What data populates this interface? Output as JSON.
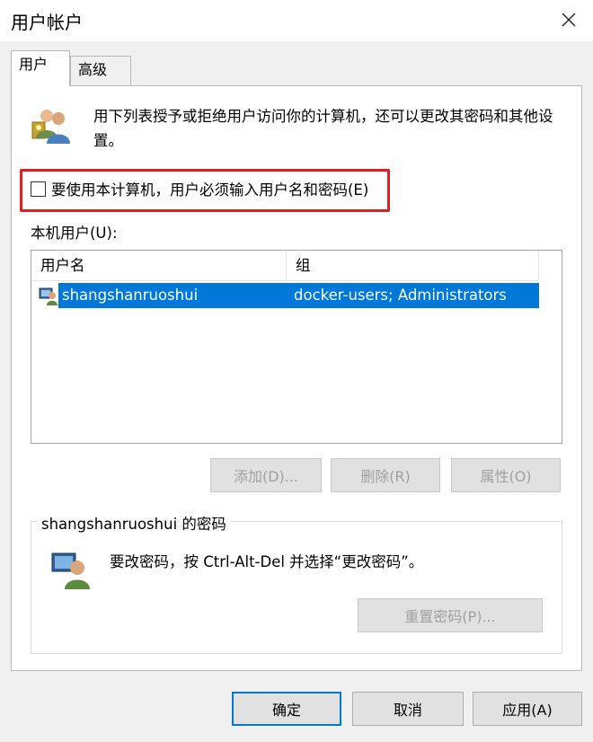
{
  "window": {
    "title": "用户帐户"
  },
  "tabs": [
    {
      "label": "用户",
      "active": true
    },
    {
      "label": "高级",
      "active": false
    }
  ],
  "intro": {
    "icon": "users-icon",
    "text": "用下列表授予或拒绝用户访问你的计算机，还可以更改其密码和其他设置。"
  },
  "require_login": {
    "label": "要使用本计算机，用户必须输入用户名和密码(E)",
    "checked": false
  },
  "local_users": {
    "label": "本机用户(U):",
    "columns": [
      "用户名",
      "组"
    ],
    "rows": [
      {
        "username": "shangshanruoshui",
        "groups": "docker-users; Administrators",
        "selected": true
      }
    ]
  },
  "user_buttons": {
    "add": "添加(D)...",
    "delete": "删除(R)",
    "properties": "属性(O)"
  },
  "password_section": {
    "title": "shangshanruoshui 的密码",
    "icon": "user-password-icon",
    "text": "要改密码，按 Ctrl-Alt-Del 并选择“更改密码”。",
    "reset_button": "重置密码(P)..."
  },
  "dialog_buttons": {
    "ok": "确定",
    "cancel": "取消",
    "apply": "应用(A)"
  },
  "colors": {
    "selection": "#0078d7",
    "highlight_border": "#e02020"
  }
}
